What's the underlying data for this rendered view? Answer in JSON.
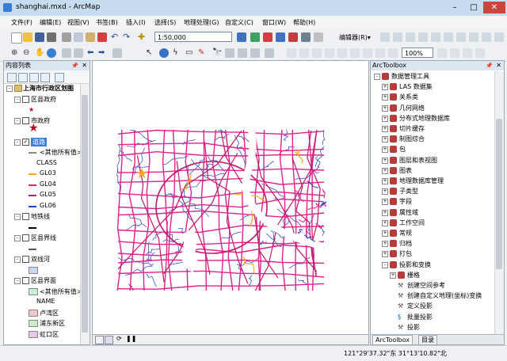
{
  "window": {
    "title": "shanghai.mxd - ArcMap"
  },
  "menu": [
    "文件(F)",
    "编辑(E)",
    "视图(V)",
    "书签(B)",
    "插入(I)",
    "选择(S)",
    "地理处理(G)",
    "自定义(C)",
    "窗口(W)",
    "帮助(H)"
  ],
  "toolbar": {
    "scale": "1:50,000",
    "editor_label": "编辑器(R)▾",
    "zoom": "100%"
  },
  "toc": {
    "title": "内容列表",
    "items": [
      {
        "type": "group",
        "label": "上海市行政区划图",
        "indent": 0,
        "check": false,
        "expand": "-"
      },
      {
        "type": "layer",
        "label": "区县政府",
        "indent": 1,
        "check": false,
        "expand": "-"
      },
      {
        "type": "legend",
        "label": "",
        "indent": 2,
        "sym": "star-small"
      },
      {
        "type": "layer",
        "label": "市政府",
        "indent": 1,
        "check": false,
        "expand": "-"
      },
      {
        "type": "legend",
        "label": "",
        "indent": 2,
        "sym": "star-big"
      },
      {
        "type": "layer",
        "label": "道路",
        "indent": 1,
        "check": true,
        "expand": "-",
        "selected": true
      },
      {
        "type": "legend",
        "label": "<其他所有值>",
        "indent": 2,
        "sym": "line",
        "color": "#888888"
      },
      {
        "type": "legend",
        "label": "CLASS",
        "indent": 3,
        "sym": "none"
      },
      {
        "type": "legend",
        "label": "GL03",
        "indent": 2,
        "sym": "line",
        "color": "#f5a623"
      },
      {
        "type": "legend",
        "label": "GL04",
        "indent": 2,
        "sym": "line",
        "color": "#e0218a"
      },
      {
        "type": "legend",
        "label": "GL05",
        "indent": 2,
        "sym": "line",
        "color": "#c0186a"
      },
      {
        "type": "legend",
        "label": "GL06",
        "indent": 2,
        "sym": "line",
        "color": "#2040c0"
      },
      {
        "type": "layer",
        "label": "地铁线",
        "indent": 1,
        "check": false,
        "expand": "-"
      },
      {
        "type": "legend",
        "label": "",
        "indent": 2,
        "sym": "line",
        "color": "#000000"
      },
      {
        "type": "layer",
        "label": "区县界线",
        "indent": 1,
        "check": false,
        "expand": "-"
      },
      {
        "type": "legend",
        "label": "",
        "indent": 2,
        "sym": "line",
        "color": "#555555"
      },
      {
        "type": "layer",
        "label": "双线河",
        "indent": 1,
        "check": false,
        "expand": "-"
      },
      {
        "type": "legend",
        "label": "",
        "indent": 2,
        "sym": "box",
        "color": "#c8d8f0"
      },
      {
        "type": "layer",
        "label": "区县界面",
        "indent": 1,
        "check": false,
        "expand": "-"
      },
      {
        "type": "legend",
        "label": "<其他所有值>",
        "indent": 2,
        "sym": "box",
        "color": "#c8f0d8"
      },
      {
        "type": "legend",
        "label": "NAME",
        "indent": 3,
        "sym": "none"
      },
      {
        "type": "legend",
        "label": "卢湾区",
        "indent": 2,
        "sym": "box",
        "color": "#f0c8c8"
      },
      {
        "type": "legend",
        "label": "浦东新区",
        "indent": 2,
        "sym": "box",
        "color": "#c8f0c8"
      },
      {
        "type": "legend",
        "label": "虹口区",
        "indent": 2,
        "sym": "box",
        "color": "#e8c8e8"
      }
    ]
  },
  "arctoolbox": {
    "title": "ArcToolbox",
    "items": [
      {
        "label": "数据管理工具",
        "indent": 0,
        "expand": "-",
        "kind": "box"
      },
      {
        "label": "LAS 数据集",
        "indent": 1,
        "expand": "+",
        "kind": "box"
      },
      {
        "label": "关系类",
        "indent": 1,
        "expand": "+",
        "kind": "box"
      },
      {
        "label": "几何网络",
        "indent": 1,
        "expand": "+",
        "kind": "box"
      },
      {
        "label": "分布式地理数据库",
        "indent": 1,
        "expand": "+",
        "kind": "box"
      },
      {
        "label": "切片缓存",
        "indent": 1,
        "expand": "+",
        "kind": "box"
      },
      {
        "label": "制图综合",
        "indent": 1,
        "expand": "+",
        "kind": "box"
      },
      {
        "label": "包",
        "indent": 1,
        "expand": "+",
        "kind": "box"
      },
      {
        "label": "图层和表视图",
        "indent": 1,
        "expand": "+",
        "kind": "box"
      },
      {
        "label": "图表",
        "indent": 1,
        "expand": "+",
        "kind": "box"
      },
      {
        "label": "地理数据库管理",
        "indent": 1,
        "expand": "+",
        "kind": "box"
      },
      {
        "label": "子类型",
        "indent": 1,
        "expand": "+",
        "kind": "box"
      },
      {
        "label": "字段",
        "indent": 1,
        "expand": "+",
        "kind": "box"
      },
      {
        "label": "属性域",
        "indent": 1,
        "expand": "+",
        "kind": "box"
      },
      {
        "label": "工作空间",
        "indent": 1,
        "expand": "+",
        "kind": "box"
      },
      {
        "label": "常规",
        "indent": 1,
        "expand": "+",
        "kind": "box"
      },
      {
        "label": "归档",
        "indent": 1,
        "expand": "+",
        "kind": "box"
      },
      {
        "label": "打包",
        "indent": 1,
        "expand": "+",
        "kind": "box"
      },
      {
        "label": "投影和变换",
        "indent": 1,
        "expand": "-",
        "kind": "box"
      },
      {
        "label": "栅格",
        "indent": 2,
        "expand": "+",
        "kind": "box"
      },
      {
        "label": "创建空间参考",
        "indent": 2,
        "expand": "",
        "kind": "tool"
      },
      {
        "label": "创建自定义地理(坐标)变换",
        "indent": 2,
        "expand": "",
        "kind": "tool"
      },
      {
        "label": "定义投影",
        "indent": 2,
        "expand": "",
        "kind": "tool"
      },
      {
        "label": "批量投影",
        "indent": 2,
        "expand": "",
        "kind": "script"
      },
      {
        "label": "投影",
        "indent": 2,
        "expand": "",
        "kind": "tool"
      }
    ],
    "tabs": [
      "ArcToolbox",
      "目录"
    ]
  },
  "status": {
    "coords": "121°29'37.32\"东  31°13'10.82\"北"
  },
  "colors": {
    "road_major": "#e0218a",
    "road_minor": "#2040c0",
    "road_orange": "#f5a623",
    "road_dark": "#c0186a"
  }
}
